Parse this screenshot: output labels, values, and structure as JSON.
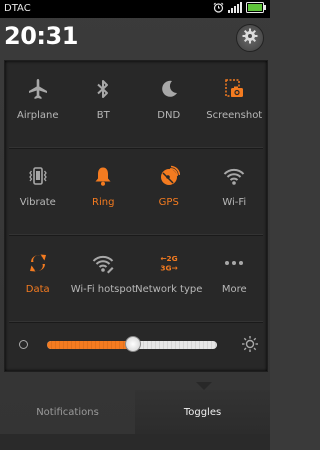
{
  "status_bar": {
    "carrier": "DTAC",
    "icons": [
      "alarm-icon",
      "signal-icon",
      "battery-icon"
    ]
  },
  "header": {
    "time": "20:31",
    "settings_icon": "gear-icon"
  },
  "toggles": [
    [
      {
        "label": "Airplane",
        "icon": "airplane-icon",
        "active": false
      },
      {
        "label": "BT",
        "icon": "bluetooth-icon",
        "active": false
      },
      {
        "label": "DND",
        "icon": "moon-icon",
        "active": false
      },
      {
        "label": "Screenshot",
        "icon": "screenshot-icon",
        "active": false
      }
    ],
    [
      {
        "label": "Vibrate",
        "icon": "vibrate-icon",
        "active": false
      },
      {
        "label": "Ring",
        "icon": "bell-icon",
        "active": true
      },
      {
        "label": "GPS",
        "icon": "gps-icon",
        "active": true
      },
      {
        "label": "Wi-Fi",
        "icon": "wifi-icon",
        "active": false
      }
    ],
    [
      {
        "label": "Data",
        "icon": "data-icon",
        "active": true
      },
      {
        "label": "Wi-Fi hotspot",
        "icon": "wifi-hotspot-icon",
        "active": false
      },
      {
        "label": "Network type",
        "icon": "network-type-icon",
        "active": true,
        "glyph_top": "←2G",
        "glyph_bottom": "3G→"
      },
      {
        "label": "More",
        "icon": "more-icon",
        "active": false
      }
    ]
  ],
  "brightness": {
    "level": 0.5
  },
  "tabs": [
    {
      "label": "Notifications",
      "active": false
    },
    {
      "label": "Toggles",
      "active": true
    }
  ],
  "colors": {
    "accent": "#f47b20",
    "icon_inactive": "#a8a8a8",
    "label_inactive": "#b8b8b8"
  }
}
